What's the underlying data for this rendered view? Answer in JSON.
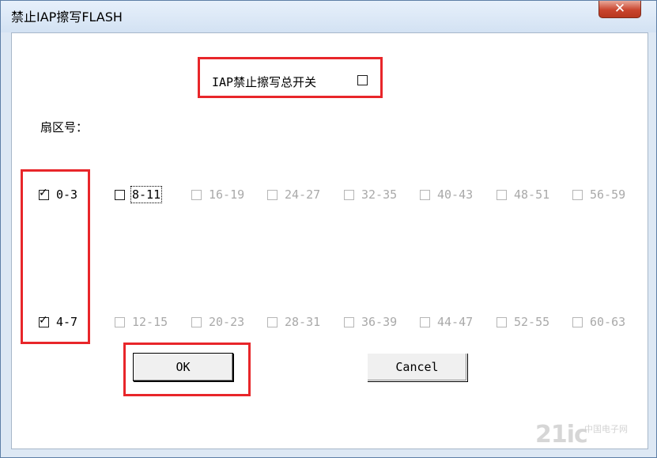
{
  "window": {
    "title": "禁止IAP擦写FLASH",
    "close_label": "✕"
  },
  "master_switch": {
    "label": "IAP禁止擦写总开关",
    "checked": false
  },
  "sector_label": "扇区号：",
  "row1": [
    {
      "label": "0-3",
      "checked": true,
      "enabled": true
    },
    {
      "label": "8-11",
      "checked": false,
      "enabled": true,
      "focused": true
    },
    {
      "label": "16-19",
      "checked": false,
      "enabled": false
    },
    {
      "label": "24-27",
      "checked": false,
      "enabled": false
    },
    {
      "label": "32-35",
      "checked": false,
      "enabled": false
    },
    {
      "label": "40-43",
      "checked": false,
      "enabled": false
    },
    {
      "label": "48-51",
      "checked": false,
      "enabled": false
    },
    {
      "label": "56-59",
      "checked": false,
      "enabled": false
    }
  ],
  "row2": [
    {
      "label": "4-7",
      "checked": true,
      "enabled": true
    },
    {
      "label": "12-15",
      "checked": false,
      "enabled": false
    },
    {
      "label": "20-23",
      "checked": false,
      "enabled": false
    },
    {
      "label": "28-31",
      "checked": false,
      "enabled": false
    },
    {
      "label": "36-39",
      "checked": false,
      "enabled": false
    },
    {
      "label": "44-47",
      "checked": false,
      "enabled": false
    },
    {
      "label": "52-55",
      "checked": false,
      "enabled": false
    },
    {
      "label": "60-63",
      "checked": false,
      "enabled": false
    }
  ],
  "buttons": {
    "ok": "OK",
    "cancel": "Cancel"
  },
  "watermark": {
    "main": "21ic",
    "sub": "中国电子网"
  },
  "colors": {
    "highlight_box": "#e8262a",
    "disabled_text": "#a9a9a9"
  }
}
